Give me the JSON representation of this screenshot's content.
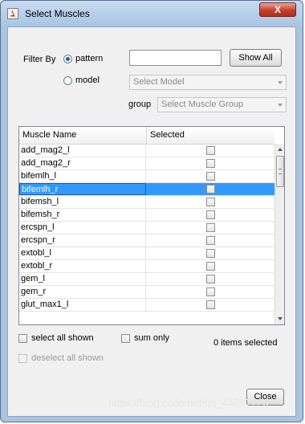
{
  "window": {
    "title": "Select Muscles",
    "close_label": "X"
  },
  "filter": {
    "label": "Filter By",
    "pattern_label": "pattern",
    "model_label": "model",
    "pattern_value": "",
    "show_all_label": "Show All",
    "model_select": "Select Model",
    "group_label": "group",
    "group_select": "Select Muscle Group"
  },
  "table": {
    "columns": [
      "Muscle Name",
      "Selected"
    ],
    "rows": [
      {
        "name": "add_mag2_l",
        "selected": false
      },
      {
        "name": "add_mag2_r",
        "selected": false
      },
      {
        "name": "bifemlh_l",
        "selected": false
      },
      {
        "name": "bifemlh_r",
        "selected": false,
        "highlighted": true
      },
      {
        "name": "bifemsh_l",
        "selected": false
      },
      {
        "name": "bifemsh_r",
        "selected": false
      },
      {
        "name": "ercspn_l",
        "selected": false
      },
      {
        "name": "ercspn_r",
        "selected": false
      },
      {
        "name": "extobl_l",
        "selected": false
      },
      {
        "name": "extobl_r",
        "selected": false
      },
      {
        "name": "gem_l",
        "selected": false
      },
      {
        "name": "gem_r",
        "selected": false
      },
      {
        "name": "glut_max1_l",
        "selected": false
      }
    ]
  },
  "footer": {
    "select_all_label": "select all shown",
    "sum_only_label": "sum only",
    "items_selected": "0 items selected",
    "deselect_all_label": "deselect all shown",
    "close_label": "Close"
  },
  "watermark": "https://blog.csdn.net/qq_44207726"
}
